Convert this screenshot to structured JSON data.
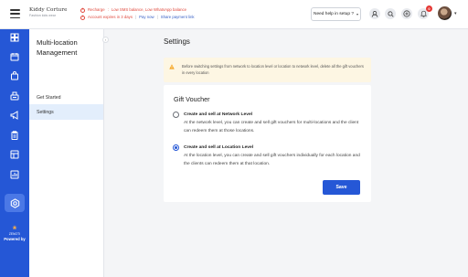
{
  "header": {
    "brand_name": "Kiddy Corture",
    "brand_tagline": "Fashion kids wear",
    "alerts": [
      {
        "label": "Recharge",
        "message": "Low SMS balance, Low WhatsApp balance"
      },
      {
        "label": "Account expires in 3 days",
        "actions": [
          "Pay now",
          "Share payment link"
        ]
      }
    ],
    "help_button_label": "Need help in setup ?",
    "notification_count": "0",
    "icons": [
      "menu-icon",
      "support-agent-icon",
      "search-icon",
      "add-icon",
      "bell-icon",
      "chevron-down-icon"
    ]
  },
  "sidebar": {
    "icons": [
      "dashboard-icon",
      "calendar-icon",
      "bag-icon",
      "cash-register-icon",
      "megaphone-icon",
      "clipboard-icon",
      "catalog-icon",
      "reports-icon",
      "settings-icon"
    ],
    "active_index": 8,
    "powered_name": "ZENOTI",
    "powered_by": "Powered by"
  },
  "subnav": {
    "title": "Multi-location Management",
    "items": [
      {
        "label": "Get Started",
        "active": false
      },
      {
        "label": "Settings",
        "active": true
      }
    ]
  },
  "main": {
    "title": "Settings",
    "warning": "Before switching settings from network to location level or location to network level, delete all the gift vouchers in every location",
    "card": {
      "title": "Gift Voucher",
      "options": [
        {
          "label": "Create and sell at Network Level",
          "description": "At the network level, you can create and sell gift vouchers for multi-locations and the client can redeem them at those locations.",
          "checked": false
        },
        {
          "label": "Create and sell at Location Level",
          "description": "At the location level, you can create and sell gift vouchers individually for each location and the clients can redeem them at that location.",
          "checked": true
        }
      ],
      "save_label": "Save"
    }
  },
  "colors": {
    "sidebar": "#2557d6",
    "primary": "#2557d6",
    "alert": "#e0483c",
    "warning_bg": "#fdf6e3",
    "active_nav": "#e3eefc"
  }
}
